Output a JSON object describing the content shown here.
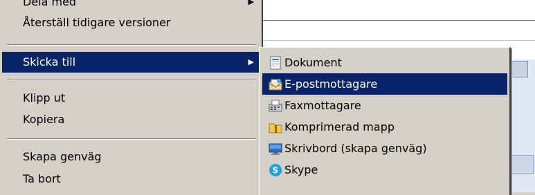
{
  "context_menu": {
    "items": [
      {
        "label": "Dela med",
        "has_submenu": true
      },
      {
        "label": "Återställ tidigare versioner"
      },
      {
        "label": "Skicka till",
        "has_submenu": true,
        "selected": true
      },
      {
        "label": "Klipp ut"
      },
      {
        "label": "Kopiera"
      },
      {
        "label": "Skapa genväg"
      },
      {
        "label": "Ta bort"
      }
    ],
    "submenu_arrow": "▶"
  },
  "send_to_submenu": {
    "items": [
      {
        "label": "Dokument",
        "icon": "document-icon"
      },
      {
        "label": "E-postmottagare",
        "icon": "email-icon",
        "selected": true
      },
      {
        "label": "Faxmottagare",
        "icon": "fax-icon"
      },
      {
        "label": "Komprimerad mapp",
        "icon": "zip-folder-icon"
      },
      {
        "label": "Skrivbord (skapa genväg)",
        "icon": "desktop-icon"
      },
      {
        "label": "Skype",
        "icon": "skype-icon"
      }
    ]
  },
  "colors": {
    "menu_bg": "#d4d0c8",
    "selection_bg": "#0a246a",
    "selection_text": "#ffffff"
  }
}
